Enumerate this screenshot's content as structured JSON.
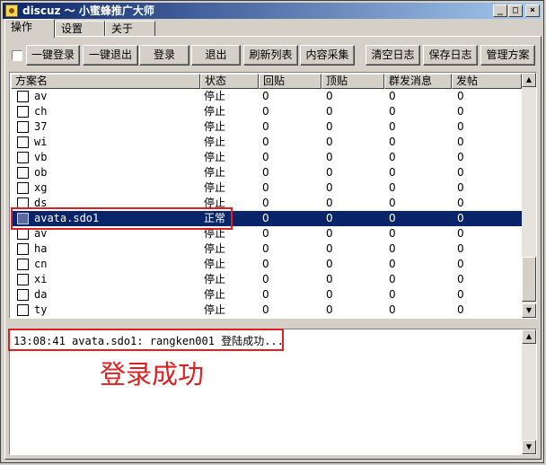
{
  "window": {
    "title": "discuz ～ 小蜜蜂推广大师",
    "minimize": "_",
    "maximize": "□",
    "close": "×"
  },
  "tabs": [
    {
      "label": "操作",
      "active": true
    },
    {
      "label": "设置",
      "active": false
    },
    {
      "label": "关于",
      "active": false
    }
  ],
  "toolbar": {
    "select_all_checked": false,
    "buttons": [
      "一键登录",
      "一键退出",
      "登录",
      "退出",
      "刷新列表",
      "内容采集",
      "清空日志",
      "保存日志",
      "管理方案"
    ]
  },
  "table": {
    "columns": [
      "方案名",
      "状态",
      "回贴",
      "顶贴",
      "群发消息",
      "发帖"
    ],
    "rows": [
      {
        "name": "av",
        "status": "停止",
        "reply": "0",
        "bump": "0",
        "broadcast": "0",
        "post": "0",
        "selected": false
      },
      {
        "name": "ch",
        "status": "停止",
        "reply": "0",
        "bump": "0",
        "broadcast": "0",
        "post": "0",
        "selected": false
      },
      {
        "name": "37",
        "status": "停止",
        "reply": "0",
        "bump": "0",
        "broadcast": "0",
        "post": "0",
        "selected": false
      },
      {
        "name": "wi",
        "status": "停止",
        "reply": "0",
        "bump": "0",
        "broadcast": "0",
        "post": "0",
        "selected": false
      },
      {
        "name": "vb",
        "status": "停止",
        "reply": "0",
        "bump": "0",
        "broadcast": "0",
        "post": "0",
        "selected": false
      },
      {
        "name": "ob",
        "status": "停止",
        "reply": "0",
        "bump": "0",
        "broadcast": "0",
        "post": "0",
        "selected": false
      },
      {
        "name": "xg",
        "status": "停止",
        "reply": "0",
        "bump": "0",
        "broadcast": "0",
        "post": "0",
        "selected": false
      },
      {
        "name": "ds",
        "status": "停止",
        "reply": "0",
        "bump": "0",
        "broadcast": "0",
        "post": "0",
        "selected": false
      },
      {
        "name": "avata.sdo1",
        "status": "正常",
        "reply": "0",
        "bump": "0",
        "broadcast": "0",
        "post": "0",
        "selected": true
      },
      {
        "name": "av",
        "status": "停止",
        "reply": "0",
        "bump": "0",
        "broadcast": "0",
        "post": "0",
        "selected": false
      },
      {
        "name": "ha",
        "status": "停止",
        "reply": "0",
        "bump": "0",
        "broadcast": "0",
        "post": "0",
        "selected": false
      },
      {
        "name": "cn",
        "status": "停止",
        "reply": "0",
        "bump": "0",
        "broadcast": "0",
        "post": "0",
        "selected": false
      },
      {
        "name": "xi",
        "status": "停止",
        "reply": "0",
        "bump": "0",
        "broadcast": "0",
        "post": "0",
        "selected": false
      },
      {
        "name": "da",
        "status": "停止",
        "reply": "0",
        "bump": "0",
        "broadcast": "0",
        "post": "0",
        "selected": false
      },
      {
        "name": "ty",
        "status": "停止",
        "reply": "0",
        "bump": "0",
        "broadcast": "0",
        "post": "0",
        "selected": false
      }
    ]
  },
  "log": {
    "lines": [
      "13:08:41 avata.sdo1: rangken001 登陆成功..."
    ]
  },
  "annotation": "登录成功",
  "colors": {
    "selection": "#0a246a",
    "annotation_red": "#e02020",
    "title_start": "#0a246a",
    "title_end": "#a6caf0"
  }
}
